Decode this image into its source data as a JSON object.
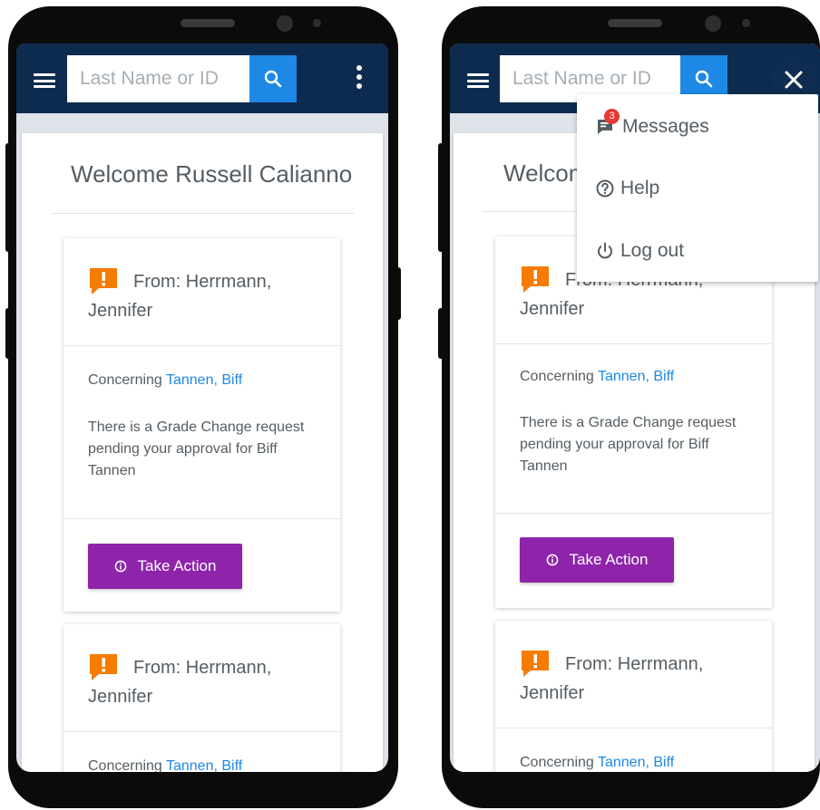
{
  "app": {
    "search": {
      "placeholder": "Last Name or ID"
    }
  },
  "welcome": "Welcome Russell Calianno",
  "welcome_partial": "Welcom",
  "cards": [
    {
      "from": "From: Herrmann, Jennifer",
      "concerning_label": "Concerning",
      "student": "Tannen, Biff",
      "message": "There is a Grade Change request pending your approval for Biff Tannen",
      "action_label": "Take Action"
    },
    {
      "from": "From: Herrmann, Jennifer",
      "concerning_label": "Concerning",
      "student": "Tannen, Biff"
    }
  ],
  "menu": {
    "items": [
      {
        "label": "Messages",
        "icon": "message-icon",
        "badge": "3"
      },
      {
        "label": "Help",
        "icon": "help-circle-icon"
      },
      {
        "label": "Log out",
        "icon": "power-icon"
      }
    ],
    "partial_from": "From: Herrmann,"
  },
  "colors": {
    "appbar": "#0d2b4e",
    "search_button": "#1e88e5",
    "link": "#1e88e5",
    "action_button": "#8e24aa",
    "alert": "#f57c00",
    "badge": "#e53935"
  }
}
